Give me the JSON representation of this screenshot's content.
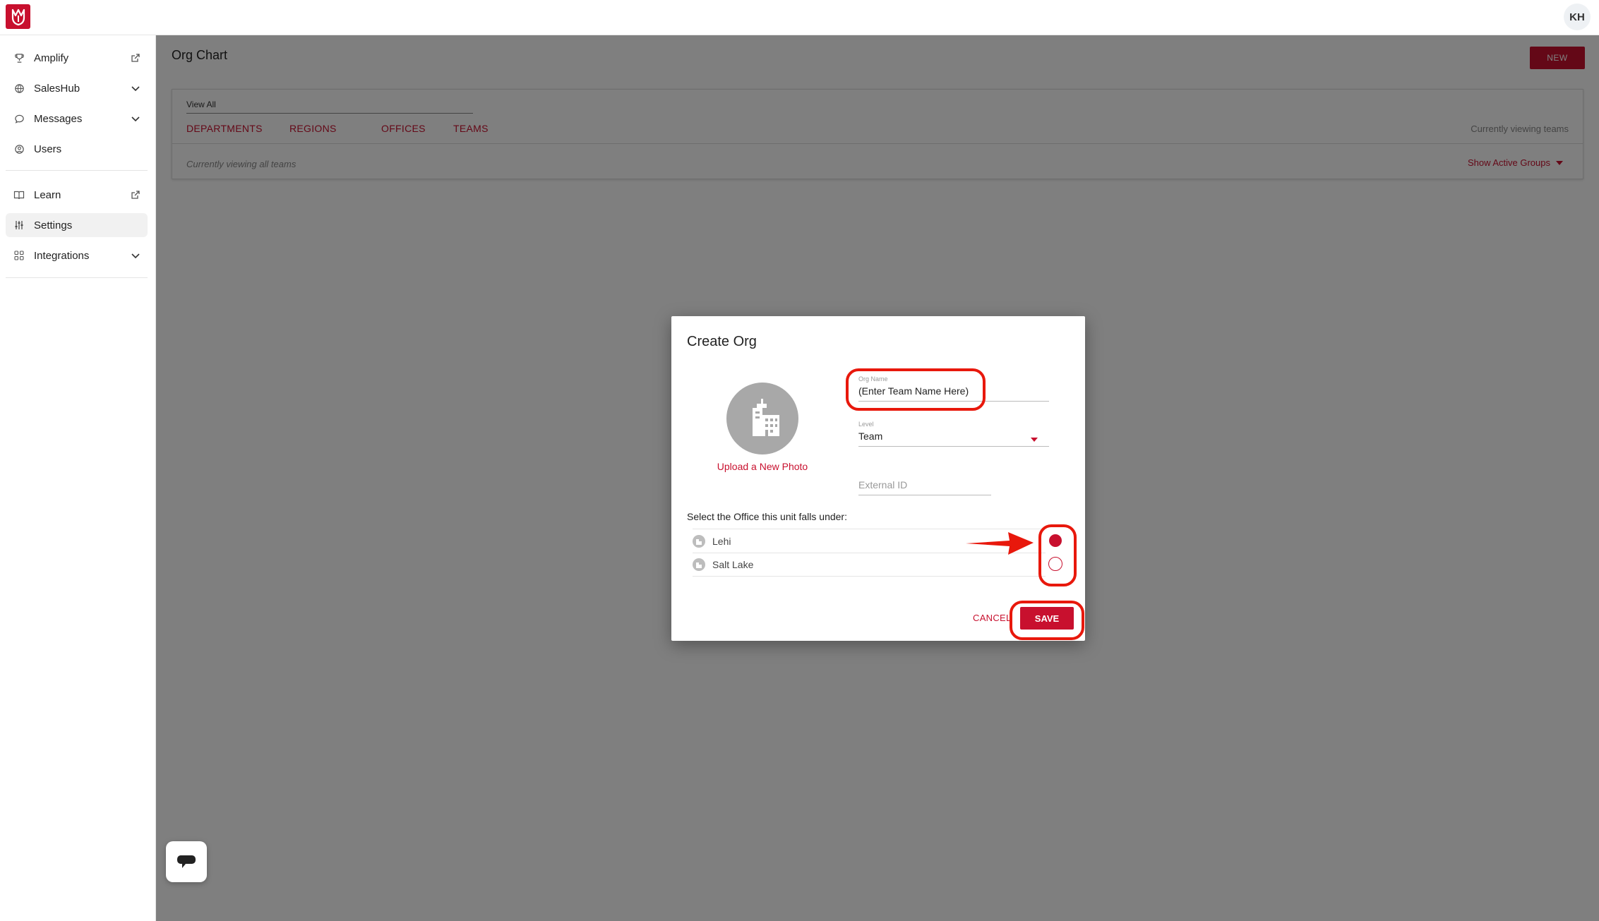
{
  "header": {
    "user_initials": "KH",
    "brand_color": "#c8102e"
  },
  "sidebar": {
    "items": [
      {
        "label": "Amplify",
        "icon": "trophy-icon",
        "trail": "external-link-icon"
      },
      {
        "label": "SalesHub",
        "icon": "globe-icon",
        "trail": "chevron-down-icon"
      },
      {
        "label": "Messages",
        "icon": "chat-bubble-icon",
        "trail": "chevron-down-icon"
      },
      {
        "label": "Users",
        "icon": "user-circle-icon",
        "trail": ""
      },
      {
        "label": "Learn",
        "icon": "book-icon",
        "trail": "external-link-icon"
      },
      {
        "label": "Settings",
        "icon": "sliders-icon",
        "trail": "",
        "active": true
      },
      {
        "label": "Integrations",
        "icon": "grid-icon",
        "trail": "chevron-down-icon"
      }
    ]
  },
  "main": {
    "title": "Org Chart",
    "new_label": "NEW",
    "view_all": "View All",
    "tabs": [
      "DEPARTMENTS",
      "REGIONS",
      "OFFICES",
      "TEAMS"
    ],
    "viewing_status": "Currently viewing teams",
    "viewing_all": "Currently viewing all teams",
    "show_active": "Show Active Groups"
  },
  "modal": {
    "title": "Create Org",
    "upload_label": "Upload a New Photo",
    "org_name_label": "Org Name",
    "org_name_value": "(Enter Team Name Here)",
    "level_label": "Level",
    "level_value": "Team",
    "external_id_placeholder": "External ID",
    "office_heading": "Select the Office this unit falls under:",
    "offices": [
      {
        "name": "Lehi",
        "selected": true
      },
      {
        "name": "Salt Lake",
        "selected": false
      }
    ],
    "cancel_label": "CANCEL",
    "save_label": "SAVE"
  }
}
